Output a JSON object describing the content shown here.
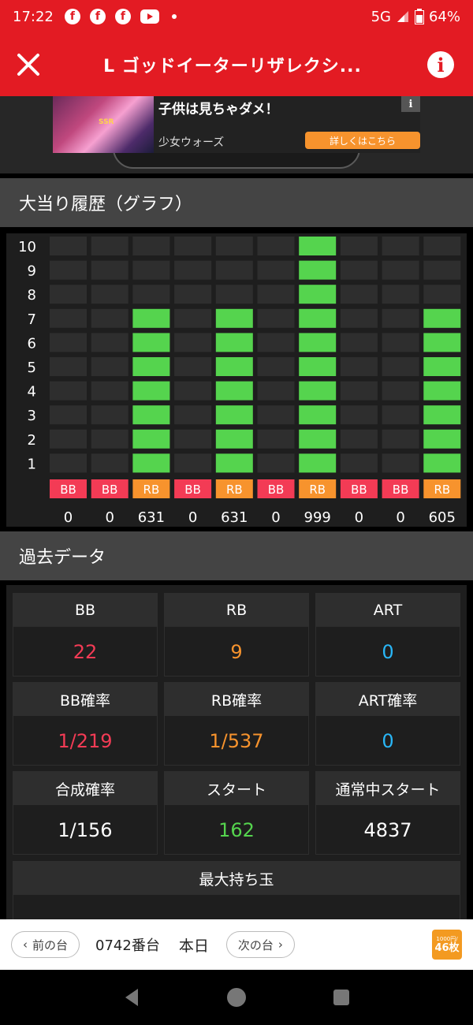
{
  "status_bar": {
    "time": "17:22",
    "network": "5G",
    "battery": "64%",
    "icons": [
      "facebook-icon",
      "facebook-icon",
      "facebook-icon",
      "youtube-icon",
      "dot-icon"
    ]
  },
  "app_bar": {
    "title": "L ゴッドイーターリザレクシ..."
  },
  "ad": {
    "headline": "子供は見ちゃダメ！",
    "brand": "少女ウォーズ",
    "cta": "詳しくはこちら",
    "ad_badge": "i",
    "image_badge": "SSR"
  },
  "graph_section": {
    "title": "大当り履歴（グラフ）"
  },
  "chart_data": {
    "type": "bar",
    "title": "大当り履歴（グラフ）",
    "ylim": [
      0,
      10
    ],
    "y_ticks": [
      "1",
      "2",
      "3",
      "4",
      "5",
      "6",
      "7",
      "8",
      "9",
      "10"
    ],
    "bars": [
      {
        "type": "BB",
        "value": 0,
        "label": "0"
      },
      {
        "type": "BB",
        "value": 0,
        "label": "0"
      },
      {
        "type": "RB",
        "value": 7,
        "label": "631"
      },
      {
        "type": "BB",
        "value": 0,
        "label": "0"
      },
      {
        "type": "RB",
        "value": 7,
        "label": "631"
      },
      {
        "type": "BB",
        "value": 0,
        "label": "0"
      },
      {
        "type": "RB",
        "value": 10,
        "label": "999"
      },
      {
        "type": "BB",
        "value": 0,
        "label": "0"
      },
      {
        "type": "BB",
        "value": 0,
        "label": "0"
      },
      {
        "type": "RB",
        "value": 7,
        "label": "605"
      }
    ],
    "colors": {
      "filled": "#55d44e",
      "empty": "#2e2e2e",
      "BB": "#f33b55",
      "RB": "#f7932d"
    }
  },
  "past_section": {
    "title": "過去データ"
  },
  "stats": [
    {
      "label": "BB",
      "value": "22",
      "color": "#f33b55"
    },
    {
      "label": "RB",
      "value": "9",
      "color": "#f7932d"
    },
    {
      "label": "ART",
      "value": "0",
      "color": "#29b6f6"
    },
    {
      "label": "BB確率",
      "value": "1/219",
      "color": "#f33b55"
    },
    {
      "label": "RB確率",
      "value": "1/537",
      "color": "#f7932d"
    },
    {
      "label": "ART確率",
      "value": "0",
      "color": "#29b6f6"
    },
    {
      "label": "合成確率",
      "value": "1/156",
      "color": "#ffffff"
    },
    {
      "label": "スタート",
      "value": "162",
      "color": "#55d44e"
    },
    {
      "label": "通常中スタート",
      "value": "4837",
      "color": "#ffffff"
    }
  ],
  "max_balls": {
    "label": "最大持ち玉"
  },
  "bottom_bar": {
    "prev": "前の台",
    "machine": "0742番台",
    "today": "本日",
    "next": "次の台",
    "coin_small": "1000円/",
    "coin_big": "46枚"
  },
  "colors": {
    "accent": "#e31b23"
  }
}
